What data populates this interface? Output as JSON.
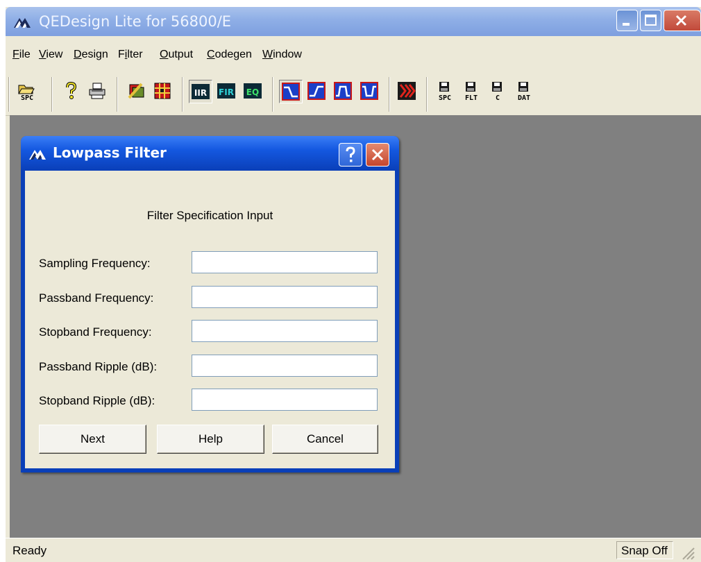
{
  "window": {
    "title": "QEDesign Lite for 56800/E"
  },
  "menu": {
    "items": [
      {
        "prefix": "",
        "underline": "F",
        "suffix": "ile"
      },
      {
        "prefix": "",
        "underline": "V",
        "suffix": "iew"
      },
      {
        "prefix": "",
        "underline": "D",
        "suffix": "esign"
      },
      {
        "prefix": "F",
        "underline": "i",
        "suffix": "lter"
      },
      {
        "prefix": "",
        "underline": "O",
        "suffix": "utput"
      },
      {
        "prefix": "",
        "underline": "C",
        "suffix": "odegen"
      },
      {
        "prefix": "",
        "underline": "W",
        "suffix": "indow"
      }
    ]
  },
  "toolbar": {
    "open_spc_label": "SPC",
    "iir_label": "IIR",
    "fir_label": "FIR",
    "eq_label": "EQ",
    "save_spc_label": "SPC",
    "save_flt_label": "FLT",
    "save_c_label": "C",
    "save_dat_label": "DAT"
  },
  "dialog": {
    "title": "Lowpass Filter",
    "heading": "Filter Specification Input",
    "fields": [
      {
        "label": "Sampling Frequency:",
        "value": ""
      },
      {
        "label": "Passband Frequency:",
        "value": ""
      },
      {
        "label": "Stopband Frequency:",
        "value": ""
      },
      {
        "label": "Passband Ripple (dB):",
        "value": ""
      },
      {
        "label": "Stopband Ripple (dB):",
        "value": ""
      }
    ],
    "buttons": {
      "next": "Next",
      "help": "Help",
      "cancel": "Cancel"
    }
  },
  "status": {
    "text": "Ready",
    "snap": "Snap Off"
  },
  "colors": {
    "client_area": "#808080",
    "dialog_frame": "#0a3fb8",
    "title_bar_inactive": "#8eaee6"
  }
}
